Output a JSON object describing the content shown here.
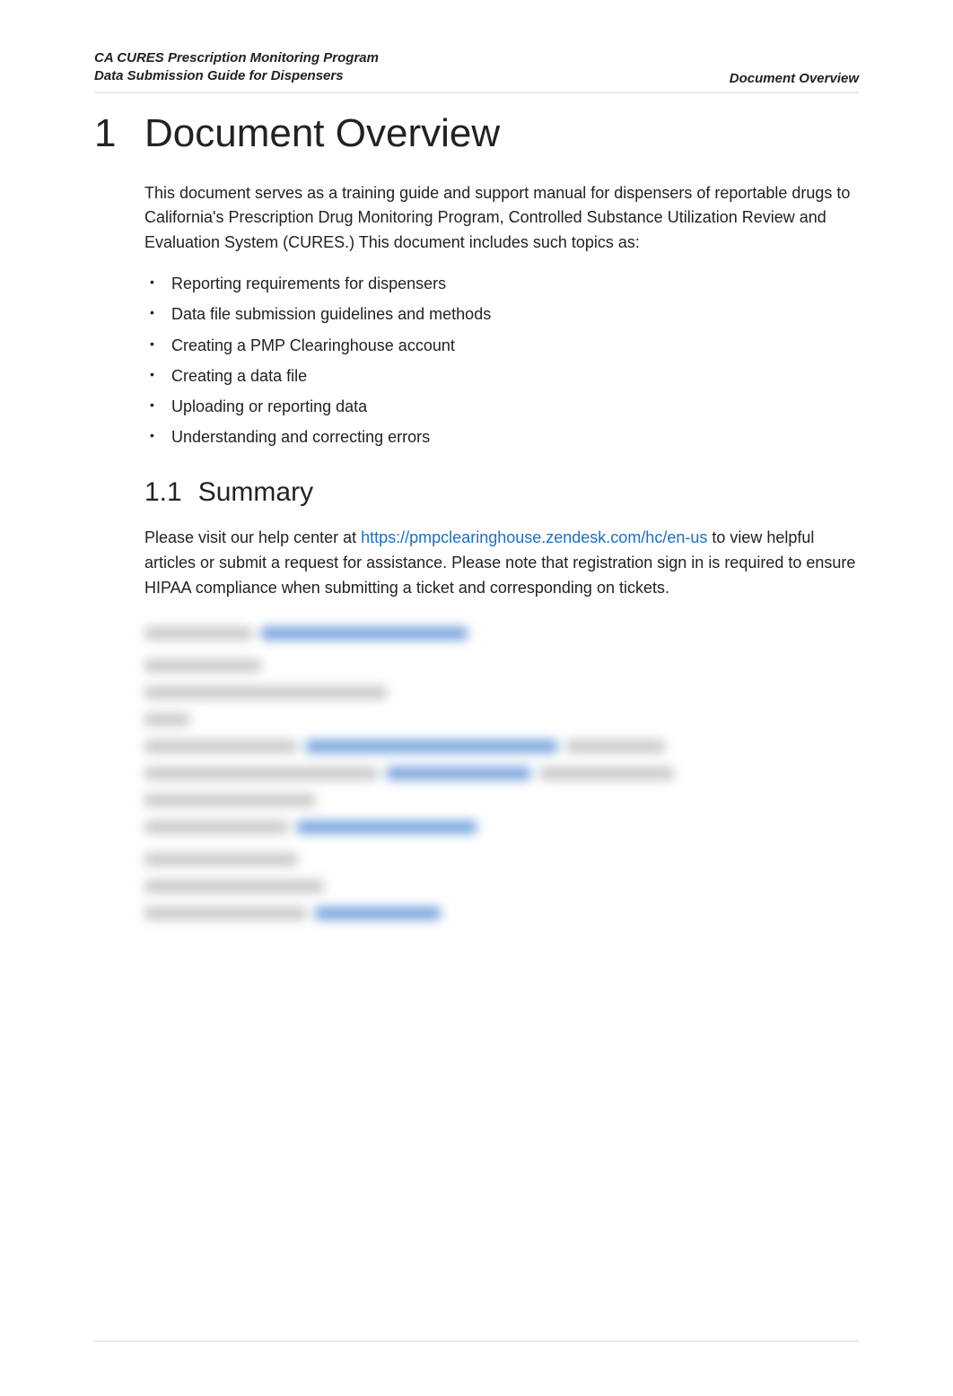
{
  "header": {
    "left_line1": "CA CURES Prescription Monitoring Program",
    "left_line2": "Data Submission Guide for Dispensers",
    "right": "Document Overview"
  },
  "section": {
    "number": "1",
    "title": "Document Overview",
    "intro": "This document serves as a training guide and support manual for dispensers of reportable drugs to California's Prescription Drug Monitoring Program, Controlled Substance Utilization Review and Evaluation System (CURES.)  This document includes such topics as:",
    "bullets": [
      "Reporting requirements for dispensers",
      "Data file submission guidelines and methods",
      "Creating a PMP Clearinghouse account",
      "Creating a data file",
      "Uploading or reporting data",
      "Understanding and correcting errors"
    ]
  },
  "subsection": {
    "number": "1.1",
    "title": "Summary",
    "para_pre": "Please visit our help center at ",
    "link_text": "https://pmpclearinghouse.zendesk.com/hc/en-us",
    "para_post": " to view helpful articles or submit a request for assistance. Please note that registration sign in is required to ensure HIPAA compliance when submitting a ticket and corresponding on tickets."
  }
}
